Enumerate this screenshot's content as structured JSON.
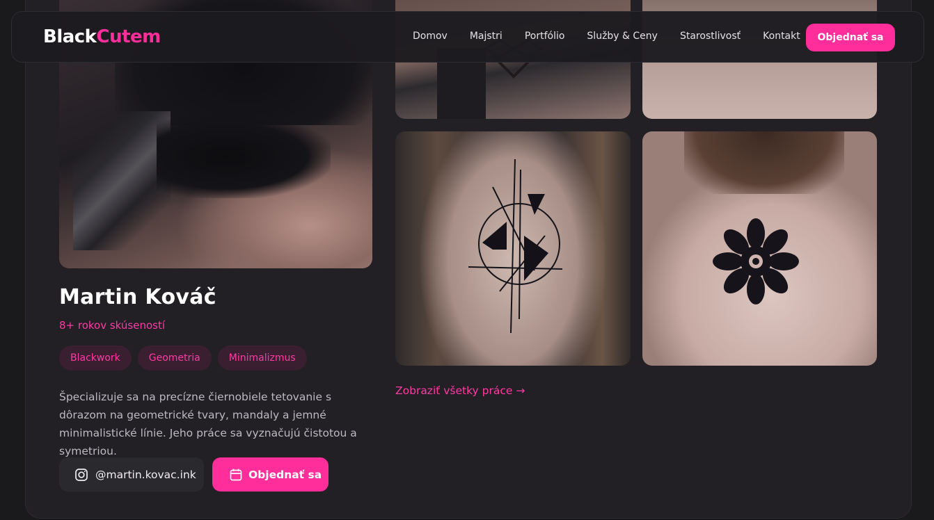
{
  "brand": {
    "logo_part1": "Black",
    "logo_part2": "Cutem",
    "accent": "#ff2e9a"
  },
  "nav": {
    "items": [
      {
        "label": "Domov"
      },
      {
        "label": "Majstri"
      },
      {
        "label": "Portfólio"
      },
      {
        "label": "Služby & Ceny"
      },
      {
        "label": "Starostlivosť"
      },
      {
        "label": "Kontakt"
      }
    ],
    "cta_label": "Objednať sa"
  },
  "artist": {
    "name": "Martin Kováč",
    "experience": "8+ rokov skúseností",
    "tags": [
      "Blackwork",
      "Geometria",
      "Minimalizmus"
    ],
    "bio": "Špecializuje sa na precízne čiernobiele tetovanie s dôrazom na geometrické tvary, mandaly a jemné minimalistické línie. Jeho práce sa vyznačujú čistotou a symetriou.",
    "instagram": "@martin.kovac.ink",
    "book_label": "Objednať sa",
    "instagram_icon": "instagram-icon",
    "calendar_icon": "calendar-icon"
  },
  "portfolio": {
    "view_all_label": "Zobraziť všetky práce →"
  }
}
